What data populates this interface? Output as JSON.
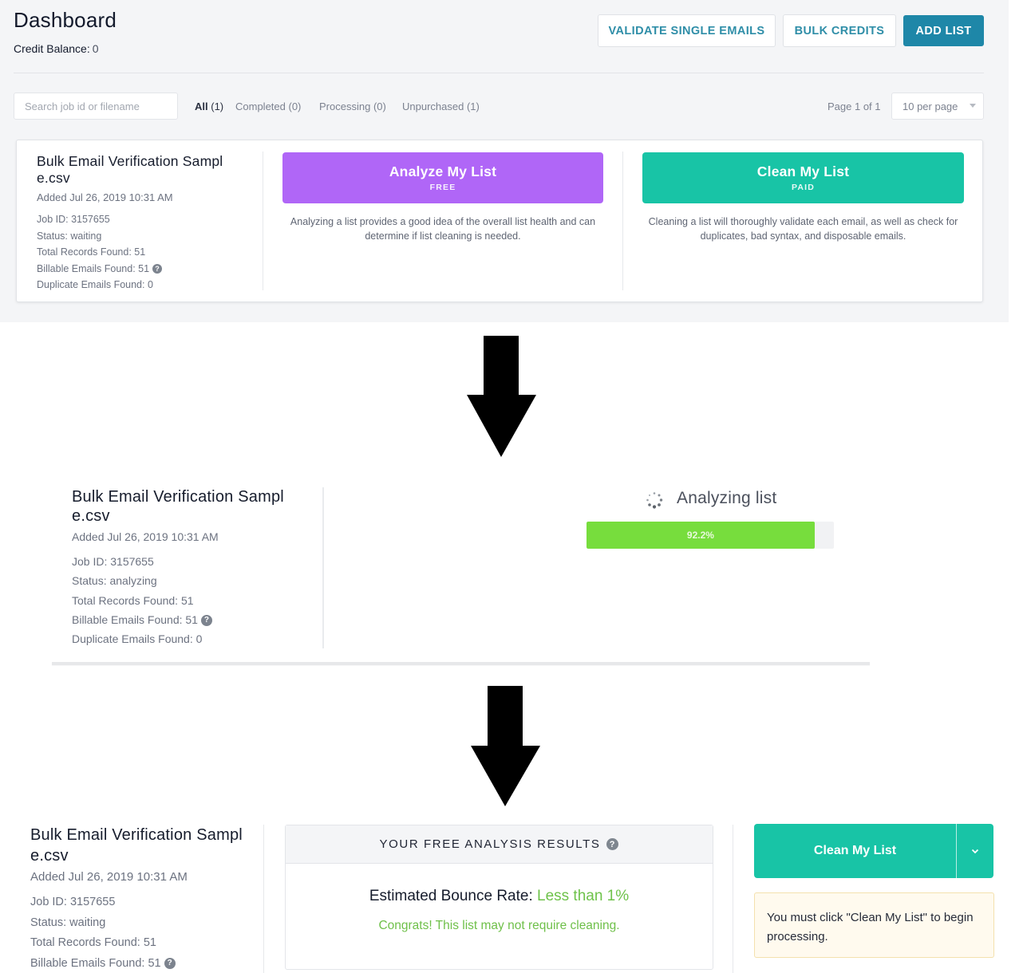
{
  "top_panel": {
    "title": "Dashboard",
    "credit_balance_label": "Credit Balance:",
    "credit_balance_value": "0",
    "header_buttons": {
      "validate": "VALIDATE SINGLE EMAILS",
      "bulk_credits": "BULK CREDITS",
      "add_list": "ADD LIST"
    },
    "search": {
      "placeholder": "Search job id or filename",
      "value": ""
    },
    "filter_tabs": [
      {
        "name": "All",
        "count": "(1)",
        "active": true
      },
      {
        "name": "Completed",
        "count": "(0)",
        "active": false
      },
      {
        "name": "Processing",
        "count": "(0)",
        "active": false
      },
      {
        "name": "Unpurchased",
        "count": "(1)",
        "active": false
      }
    ],
    "page_info": "Page 1 of 1",
    "per_page": "10 per page",
    "job": {
      "filename_line1": "Bulk Email Verification Sampl",
      "filename_line2": "e.csv",
      "added": "Added Jul 26, 2019 10:31 AM",
      "job_id": "Job ID: 3157655",
      "status": "Status: waiting",
      "total_records": "Total Records Found: 51",
      "billable": "Billable Emails Found: 51",
      "duplicates": "Duplicate Emails Found: 0"
    },
    "analyze_button": {
      "label": "Analyze My List",
      "sub": "FREE",
      "color": "#b066f7"
    },
    "analyze_desc": "Analyzing a list provides a good idea of the overall list health and can determine if list cleaning is needed.",
    "clean_button": {
      "label": "Clean My List",
      "sub": "PAID",
      "color": "#18c4a6"
    },
    "clean_desc": "Cleaning a list will thoroughly validate each email, as well as check for duplicates, bad syntax, and disposable emails."
  },
  "middle_panel": {
    "job": {
      "filename_line1": "Bulk Email Verification Sampl",
      "filename_line2": "e.csv",
      "added": "Added Jul 26, 2019 10:31 AM",
      "job_id": "Job ID: 3157655",
      "status": "Status: analyzing",
      "total_records": "Total Records Found: 51",
      "billable": "Billable Emails Found: 51",
      "duplicates": "Duplicate Emails Found: 0"
    },
    "analyzing_label": "Analyzing list",
    "progress": {
      "percent": 92.2,
      "label": "92.2%",
      "color": "#77dd3d"
    }
  },
  "bottom_panel": {
    "job": {
      "filename_line1": "Bulk Email Verification Sampl",
      "filename_line2": "e.csv",
      "added": "Added Jul 26, 2019 10:31 AM",
      "job_id": "Job ID: 3157655",
      "status": "Status: waiting",
      "total_records": "Total Records Found: 51",
      "billable": "Billable Emails Found: 51"
    },
    "results_title": "YOUR FREE ANALYSIS RESULTS",
    "bounce_label": "Estimated Bounce Rate:",
    "bounce_value": "Less than 1%",
    "congrats": "Congrats! This list may not require cleaning.",
    "clean_button": "Clean My List",
    "notice": "You must click \"Clean My List\" to begin processing."
  },
  "icons": {
    "help": "?",
    "arrow": "down-arrow",
    "spinner": "loading-spinner",
    "dropdown": "chevron-down"
  },
  "colors": {
    "accent_blue": "#1e87a8",
    "purple": "#b066f7",
    "teal": "#18c4a6",
    "success_green": "#6ec24a",
    "progress_green": "#77dd3d"
  }
}
